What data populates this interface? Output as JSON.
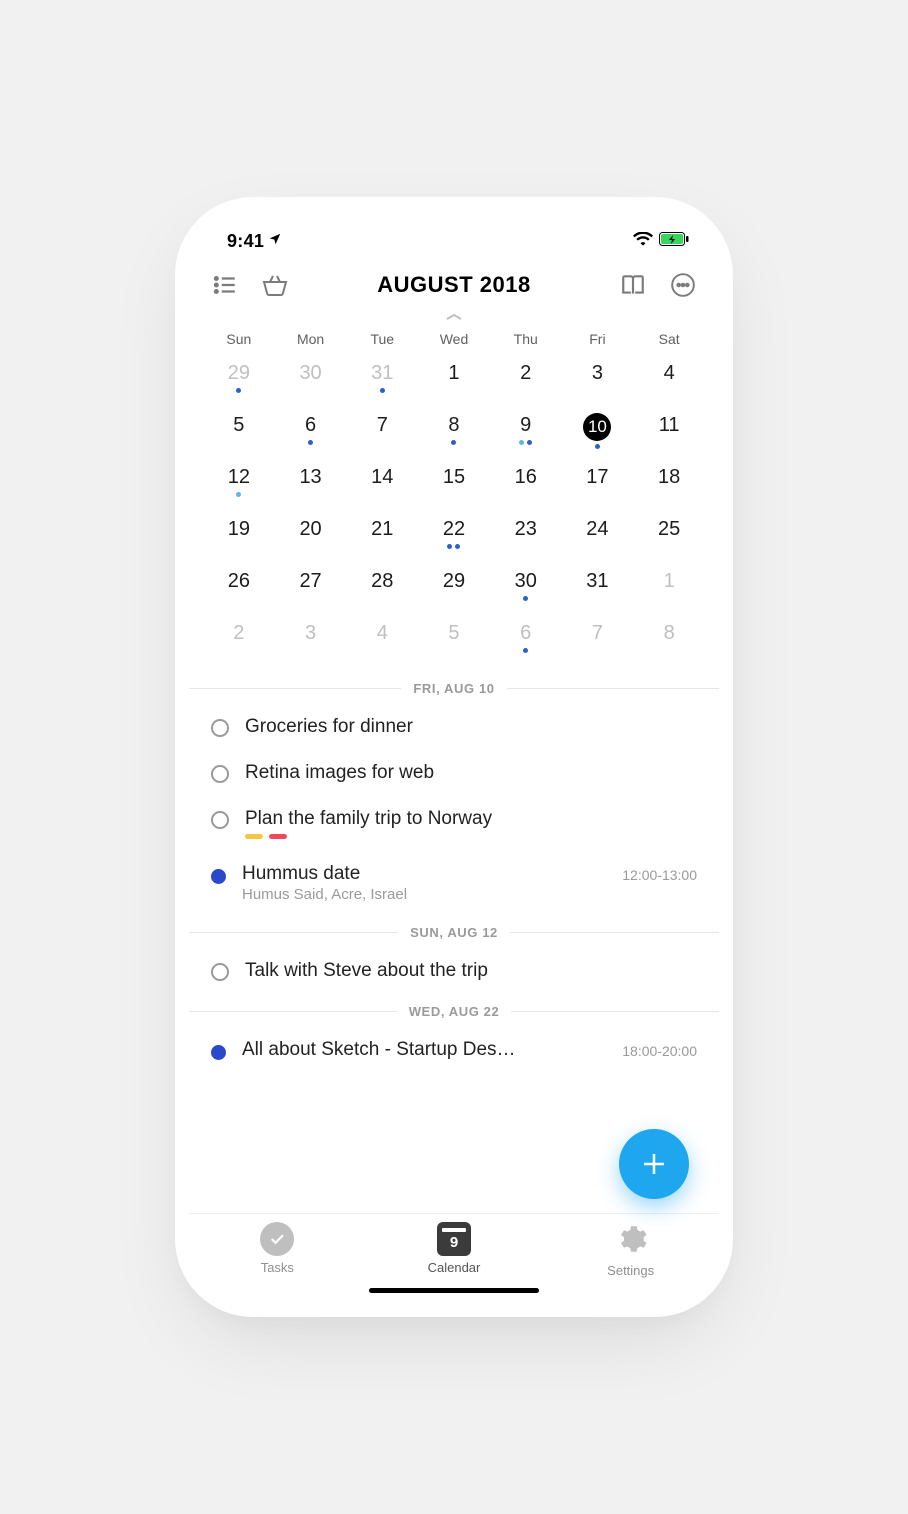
{
  "status": {
    "time": "9:41"
  },
  "header": {
    "month_title": "AUGUST 2018"
  },
  "weekdays": [
    "Sun",
    "Mon",
    "Tue",
    "Wed",
    "Thu",
    "Fri",
    "Sat"
  ],
  "calendar": {
    "rows": [
      [
        {
          "n": "29",
          "out": true,
          "dots": [
            "b"
          ]
        },
        {
          "n": "30",
          "out": true
        },
        {
          "n": "31",
          "out": true,
          "dots": [
            "b"
          ]
        },
        {
          "n": "1"
        },
        {
          "n": "2"
        },
        {
          "n": "3"
        },
        {
          "n": "4"
        }
      ],
      [
        {
          "n": "5"
        },
        {
          "n": "6",
          "dots": [
            "b"
          ]
        },
        {
          "n": "7"
        },
        {
          "n": "8",
          "dots": [
            "b"
          ]
        },
        {
          "n": "9",
          "dots": [
            "l",
            "b"
          ]
        },
        {
          "n": "10",
          "sel": true,
          "dots": [
            "b"
          ]
        },
        {
          "n": "11"
        }
      ],
      [
        {
          "n": "12",
          "dots": [
            "l"
          ]
        },
        {
          "n": "13"
        },
        {
          "n": "14"
        },
        {
          "n": "15"
        },
        {
          "n": "16"
        },
        {
          "n": "17"
        },
        {
          "n": "18"
        }
      ],
      [
        {
          "n": "19"
        },
        {
          "n": "20"
        },
        {
          "n": "21"
        },
        {
          "n": "22",
          "dots": [
            "b",
            "b"
          ]
        },
        {
          "n": "23"
        },
        {
          "n": "24"
        },
        {
          "n": "25"
        }
      ],
      [
        {
          "n": "26"
        },
        {
          "n": "27"
        },
        {
          "n": "28"
        },
        {
          "n": "29"
        },
        {
          "n": "30",
          "dots": [
            "b"
          ]
        },
        {
          "n": "31"
        },
        {
          "n": "1",
          "out": true
        }
      ],
      [
        {
          "n": "2",
          "out": true
        },
        {
          "n": "3",
          "out": true
        },
        {
          "n": "4",
          "out": true
        },
        {
          "n": "5",
          "out": true
        },
        {
          "n": "6",
          "out": true,
          "dots": [
            "b"
          ]
        },
        {
          "n": "7",
          "out": true
        },
        {
          "n": "8",
          "out": true
        }
      ]
    ]
  },
  "sections": [
    {
      "header": "FRI, AUG 10",
      "items": [
        {
          "kind": "task",
          "title": "Groceries for dinner"
        },
        {
          "kind": "task",
          "title": "Retina images for web"
        },
        {
          "kind": "task",
          "title": "Plan the family trip to Norway",
          "tags": [
            "y",
            "r"
          ]
        },
        {
          "kind": "event",
          "title": "Hummus date",
          "sub": "Humus Said, Acre, Israel",
          "time": "12:00-13:00"
        }
      ]
    },
    {
      "header": "SUN, AUG 12",
      "items": [
        {
          "kind": "task",
          "title": "Talk with Steve about the trip"
        }
      ]
    },
    {
      "header": "WED, AUG 22",
      "items": [
        {
          "kind": "event",
          "title": "All about Sketch - Startup Des…",
          "time": "18:00-20:00"
        }
      ]
    }
  ],
  "tabs": {
    "tasks": "Tasks",
    "calendar": "Calendar",
    "calendar_day": "9",
    "settings": "Settings"
  }
}
